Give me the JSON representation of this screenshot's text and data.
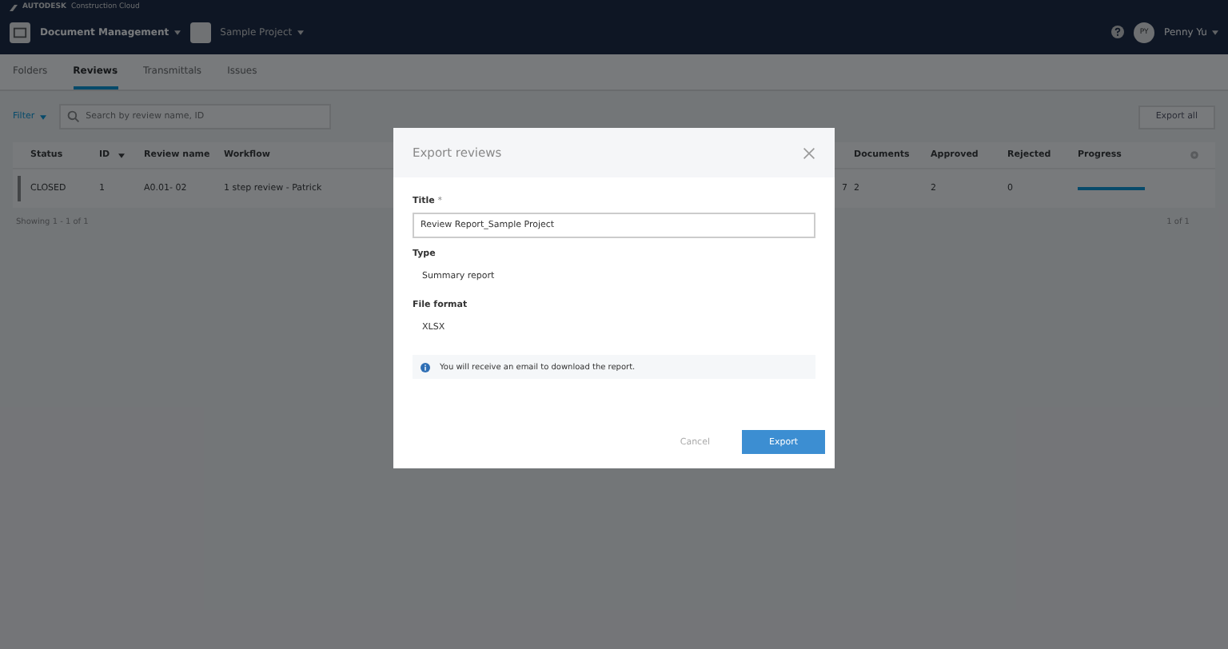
{
  "brand": {
    "company": "AUTODESK",
    "product": "Construction Cloud"
  },
  "header": {
    "module": "Document Management",
    "project": "Sample Project",
    "user": "Penny Yu",
    "avatar_initials": "PY"
  },
  "tabs": [
    {
      "label": "Folders",
      "selected": false
    },
    {
      "label": "Reviews",
      "selected": true
    },
    {
      "label": "Transmittals",
      "selected": false
    },
    {
      "label": "Issues",
      "selected": false
    }
  ],
  "toolbar": {
    "filter": "Filter",
    "search_placeholder": "Search by review name, ID",
    "export_all": "Export all"
  },
  "table": {
    "columns": [
      "Status",
      "ID",
      "Review name",
      "Workflow",
      "Documents",
      "Approved",
      "Rejected",
      "Progress"
    ],
    "rows": [
      {
        "status": "CLOSED",
        "id": "1",
        "name": "A0.01- 02",
        "workflow": "1 step review - Patrick",
        "column_5": "7",
        "documents": "2",
        "approved": "2",
        "rejected": "0",
        "level": 1
      }
    ]
  },
  "pagination": {
    "summary": "Showing 1 - 1 of 1",
    "page": "1 of 1"
  },
  "dialog": {
    "title": "Export reviews",
    "title_label": "Title",
    "required_mark": "*",
    "title_value": "Review Report_Sample Project",
    "type_label": "Type",
    "type_value": "Summary report",
    "format_label": "File format",
    "format_value": "XLSX",
    "notice": "You will receive an email to download the report.",
    "buttons": [
      "Cancel",
      "Export"
    ]
  }
}
